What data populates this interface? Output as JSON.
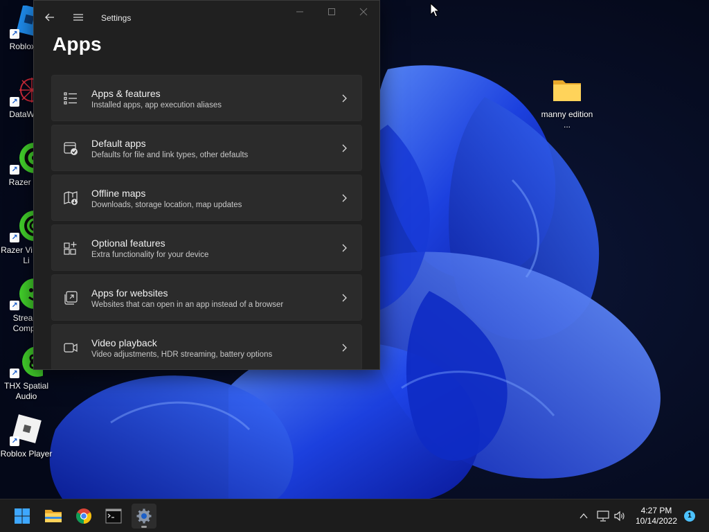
{
  "colors": {
    "window_bg": "#202020",
    "card_bg": "#2b2b2b",
    "accent": "#4cc2ff",
    "wallpaper_blue": "#1f4ff0"
  },
  "desktop": {
    "icons": [
      {
        "label": "Roblox S",
        "icon": "roblox-studio-icon"
      },
      {
        "label": "DataWag",
        "icon": "datawag-icon"
      },
      {
        "label": "Razer Co",
        "icon": "razer-cortex-icon"
      },
      {
        "label": "Razer Vi Ring Li",
        "icon": "razer-ring-light-icon"
      },
      {
        "label": "Stream Compa",
        "icon": "stream-companion-icon"
      },
      {
        "label": "THX Spatial Audio",
        "icon": "thx-spatial-audio-icon"
      },
      {
        "label": "Roblox Player",
        "icon": "roblox-player-icon"
      },
      {
        "label": "manny edition ...",
        "icon": "folder-icon"
      }
    ]
  },
  "window": {
    "title": "Settings",
    "page_title": "Apps",
    "items": [
      {
        "title": "Apps & features",
        "subtitle": "Installed apps, app execution aliases",
        "icon": "apps-list-icon"
      },
      {
        "title": "Default apps",
        "subtitle": "Defaults for file and link types, other defaults",
        "icon": "default-apps-icon"
      },
      {
        "title": "Offline maps",
        "subtitle": "Downloads, storage location, map updates",
        "icon": "offline-maps-icon"
      },
      {
        "title": "Optional features",
        "subtitle": "Extra functionality for your device",
        "icon": "optional-features-icon"
      },
      {
        "title": "Apps for websites",
        "subtitle": "Websites that can open in an app instead of a browser",
        "icon": "apps-for-websites-icon"
      },
      {
        "title": "Video playback",
        "subtitle": "Video adjustments, HDR streaming, battery options",
        "icon": "video-playback-icon"
      }
    ]
  },
  "taskbar": {
    "apps": [
      "start-icon",
      "file-explorer-icon",
      "chrome-icon",
      "terminal-icon",
      "settings-icon"
    ],
    "tray": [
      "chevron-up-icon",
      "network-icon",
      "volume-icon"
    ],
    "time": "4:27 PM",
    "date": "10/14/2022",
    "notification_count": "1"
  }
}
